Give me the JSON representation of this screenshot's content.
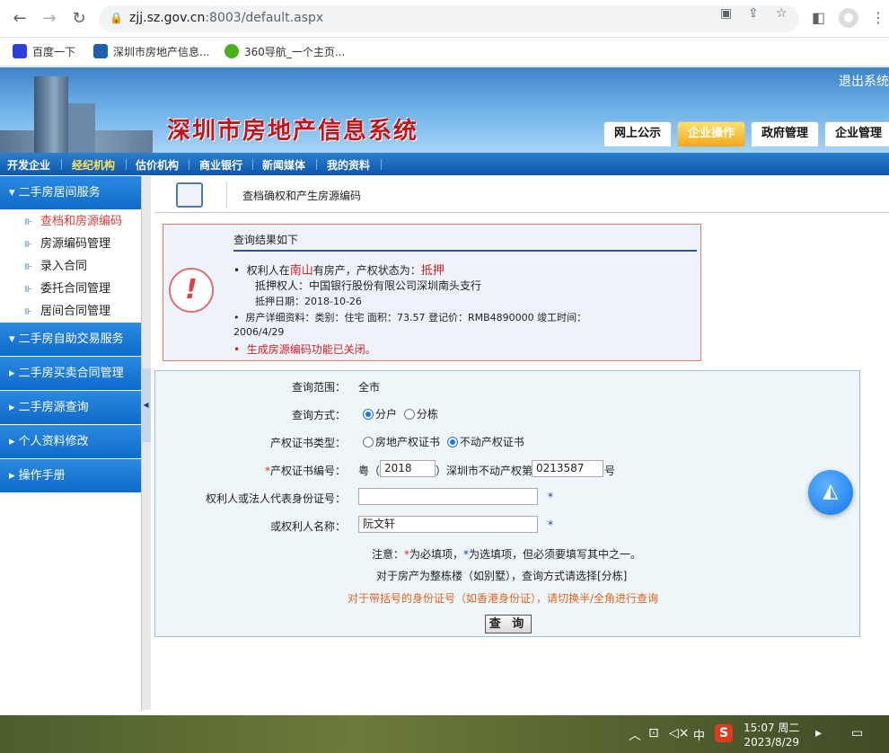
{
  "browser": {
    "url_host": "zjj.sz.gov.cn",
    "url_path": ":8003/default.aspx"
  },
  "bookmarks": [
    {
      "label": "百度一下"
    },
    {
      "label": "深圳市房地产信息..."
    },
    {
      "label": "360导航_一个主页..."
    }
  ],
  "banner": {
    "title": "深圳市房地产信息系统",
    "logout": "退出系统",
    "tabs": [
      "网上公示",
      "企业操作",
      "政府管理",
      "企业管理"
    ]
  },
  "menu": [
    "开发企业",
    "经纪机构",
    "估价机构",
    "商业银行",
    "新闻媒体",
    "我的资料"
  ],
  "sidebar": {
    "head1": "二手房居间服务",
    "items": [
      "查档和房源编码",
      "房源编码管理",
      "录入合同",
      "委托合同管理",
      "居间合同管理"
    ],
    "head2": "二手房自助交易服务",
    "head3": "二手房买卖合同管理",
    "head4": "二手房源查询",
    "head5": "个人资料修改",
    "head6": "操作手册"
  },
  "crumb": "查档确权和产生房源编码",
  "result": {
    "header": "查询结果如下",
    "l1a": "权利人在",
    "l1b": "南山",
    "l1c": "有房产，产权状态为：",
    "l1d": "抵押",
    "l2": "抵押权人：中国银行股份有限公司深圳南头支行",
    "l3": "抵押日期：2018-10-26",
    "l4": "房产详细资料：类别：住宅    面积：73.57    登记价：RMB4890000    竣工时间：",
    "l5": "2006/4/29",
    "l6": "生成房源编码功能已关闭。"
  },
  "form": {
    "scope_label": "查询范围：",
    "scope_value": "全市",
    "mode_label": "查询方式：",
    "mode_opt1": "分户",
    "mode_opt2": "分栋",
    "cert_type_label": "产权证书类型：",
    "cert_opt1": "房地产权证书",
    "cert_opt2": "不动产权证书",
    "cert_no_label": "产权证书编号：",
    "cert_prefix": "粤（",
    "cert_year": "2018",
    "cert_mid": "）深圳市不动产权第",
    "cert_number": "0213587",
    "cert_suffix": "号",
    "id_label": "权利人或法人代表身份证号：",
    "id_value": "",
    "name_label": "或权利人名称：",
    "name_value": "阮文轩",
    "note1a": "注意：",
    "note1b": "为必填项，",
    "note1c": "为选填项，但必须要填写其中之一。",
    "note2": "对于房产为整栋楼（如别墅），查询方式请选择[分栋]",
    "note3": "对于带括号的身份证号（如香港身份证），请切换半/全角进行查询",
    "button": "查 询"
  },
  "taskbar": {
    "time": "15:07 周二",
    "date": "2023/8/29",
    "ime": "中"
  }
}
